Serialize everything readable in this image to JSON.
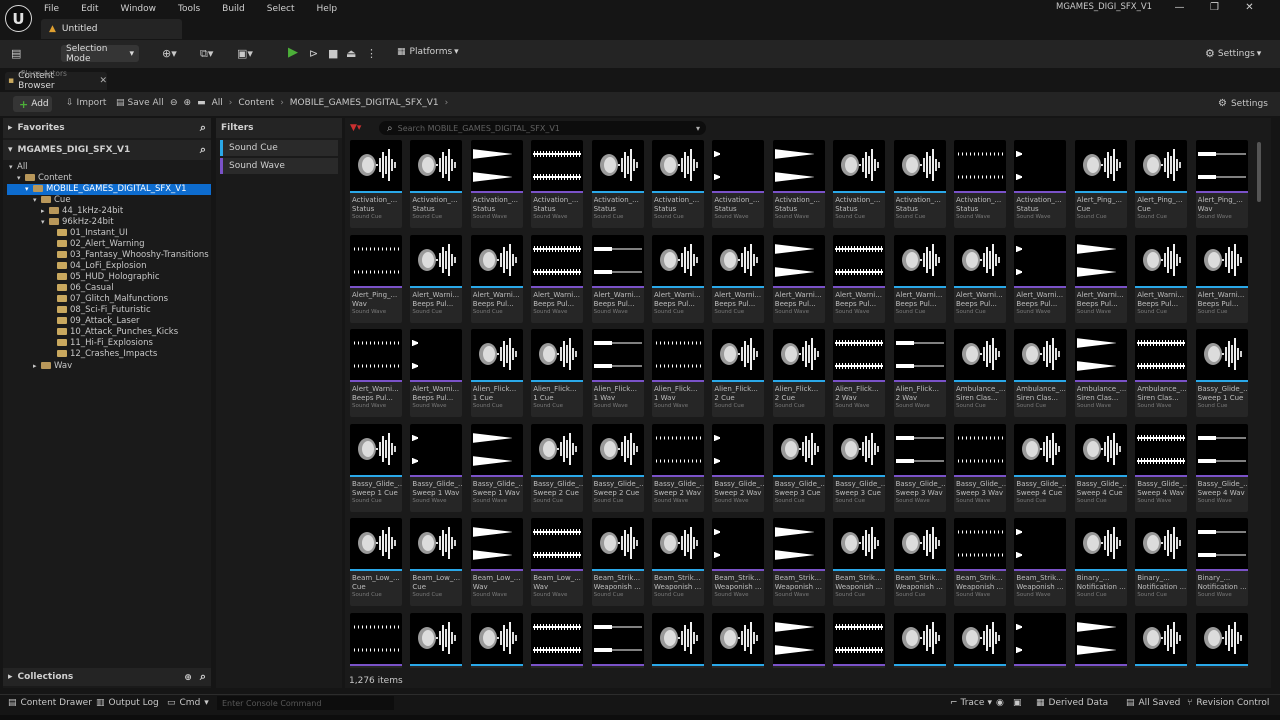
{
  "app": {
    "logo_letter": "U",
    "menu": [
      "File",
      "Edit",
      "Window",
      "Tools",
      "Build",
      "Select",
      "Help"
    ],
    "doc_tab": "Untitled",
    "project": "MGAMES_DIGI_SFX_V1",
    "window_controls": [
      "—",
      "❐",
      "✕"
    ]
  },
  "toolbar": {
    "mode": "Selection Mode",
    "platforms": "Platforms",
    "settings": "Settings"
  },
  "tabs": {
    "ghost": "Place Actors",
    "content_browser": "Content Browser"
  },
  "browser": {
    "add": "Add",
    "import": "Import",
    "save_all": "Save All",
    "breadcrumbs": [
      "All",
      "Content",
      "MOBILE_GAMES_DIGITAL_SFX_V1"
    ],
    "settings": "Settings",
    "search_placeholder": "Search MOBILE_GAMES_DIGITAL_SFX_V1",
    "item_count": "1,276 items"
  },
  "left": {
    "favorites": "Favorites",
    "root": "MGAMES_DIGI_SFX_V1",
    "collections": "Collections",
    "tree": [
      {
        "label": "All",
        "depth": 0,
        "folder": false,
        "sel": false
      },
      {
        "label": "Content",
        "depth": 1,
        "folder": true,
        "sel": false
      },
      {
        "label": "MOBILE_GAMES_DIGITAL_SFX_V1",
        "depth": 2,
        "folder": true,
        "sel": true
      },
      {
        "label": "Cue",
        "depth": 3,
        "folder": true,
        "sel": false
      },
      {
        "label": "44_1kHz-24bit",
        "depth": 4,
        "folder": true,
        "sel": false
      },
      {
        "label": "96kHz-24bit",
        "depth": 4,
        "folder": true,
        "sel": false
      },
      {
        "label": "01_Instant_UI",
        "depth": 5,
        "folder": true,
        "sel": false
      },
      {
        "label": "02_Alert_Warning",
        "depth": 5,
        "folder": true,
        "sel": false
      },
      {
        "label": "03_Fantasy_Whooshy-Transitions",
        "depth": 5,
        "folder": true,
        "sel": false
      },
      {
        "label": "04_LoFi_Explosion",
        "depth": 5,
        "folder": true,
        "sel": false
      },
      {
        "label": "05_HUD_Holographic",
        "depth": 5,
        "folder": true,
        "sel": false
      },
      {
        "label": "06_Casual",
        "depth": 5,
        "folder": true,
        "sel": false
      },
      {
        "label": "07_Glitch_Malfunctions",
        "depth": 5,
        "folder": true,
        "sel": false
      },
      {
        "label": "08_Sci-Fi_Futuristic",
        "depth": 5,
        "folder": true,
        "sel": false
      },
      {
        "label": "09_Attack_Laser",
        "depth": 5,
        "folder": true,
        "sel": false
      },
      {
        "label": "10_Attack_Punches_Kicks",
        "depth": 5,
        "folder": true,
        "sel": false
      },
      {
        "label": "11_Hi-Fi_Explosions",
        "depth": 5,
        "folder": true,
        "sel": false
      },
      {
        "label": "12_Crashes_Impacts",
        "depth": 5,
        "folder": true,
        "sel": false
      },
      {
        "label": "Wav",
        "depth": 3,
        "folder": true,
        "sel": false
      }
    ]
  },
  "filters": {
    "title": "Filters",
    "items": [
      {
        "label": "Sound Cue",
        "color": "#2aa8e8"
      },
      {
        "label": "Sound Wave",
        "color": "#7a52c8"
      }
    ]
  },
  "colors": {
    "cue": "#2aa8e8",
    "wave": "#7a52c8"
  },
  "assets": [
    {
      "n1": "Activation_...",
      "n2": "Status",
      "type": "Sound Cue",
      "kind": "cue"
    },
    {
      "n1": "Activation_...",
      "n2": "Status",
      "type": "Sound Cue",
      "kind": "cue"
    },
    {
      "n1": "Activation_...",
      "n2": "Status",
      "type": "Sound Wave",
      "kind": "wave"
    },
    {
      "n1": "Activation_...",
      "n2": "Status",
      "type": "Sound Wave",
      "kind": "wave"
    },
    {
      "n1": "Activation_...",
      "n2": "Status",
      "type": "Sound Cue",
      "kind": "cue"
    },
    {
      "n1": "Activation_...",
      "n2": "Status",
      "type": "Sound Cue",
      "kind": "cue"
    },
    {
      "n1": "Activation_...",
      "n2": "Status",
      "type": "Sound Wave",
      "kind": "wave"
    },
    {
      "n1": "Activation_...",
      "n2": "Status",
      "type": "Sound Wave",
      "kind": "wave"
    },
    {
      "n1": "Activation_...",
      "n2": "Status",
      "type": "Sound Cue",
      "kind": "cue"
    },
    {
      "n1": "Activation_...",
      "n2": "Status",
      "type": "Sound Cue",
      "kind": "cue"
    },
    {
      "n1": "Activation_...",
      "n2": "Status",
      "type": "Sound Wave",
      "kind": "wave"
    },
    {
      "n1": "Activation_...",
      "n2": "Status",
      "type": "Sound Wave",
      "kind": "wave"
    },
    {
      "n1": "Alert_Ping_...",
      "n2": "Cue",
      "type": "Sound Cue",
      "kind": "cue"
    },
    {
      "n1": "Alert_Ping_...",
      "n2": "Cue",
      "type": "Sound Cue",
      "kind": "cue"
    },
    {
      "n1": "Alert_Ping_...",
      "n2": "Wav",
      "type": "Sound Wave",
      "kind": "wave"
    },
    {
      "n1": "Alert_Ping_...",
      "n2": "Wav",
      "type": "Sound Wave",
      "kind": "wave"
    },
    {
      "n1": "Alert_Warni...",
      "n2": "Beeps Pul...",
      "type": "Sound Cue",
      "kind": "cue"
    },
    {
      "n1": "Alert_Warni...",
      "n2": "Beeps Pul...",
      "type": "Sound Cue",
      "kind": "cue"
    },
    {
      "n1": "Alert_Warni...",
      "n2": "Beeps Pul...",
      "type": "Sound Wave",
      "kind": "wave"
    },
    {
      "n1": "Alert_Warni...",
      "n2": "Beeps Pul...",
      "type": "Sound Wave",
      "kind": "wave"
    },
    {
      "n1": "Alert_Warni...",
      "n2": "Beeps Pul...",
      "type": "Sound Cue",
      "kind": "cue"
    },
    {
      "n1": "Alert_Warni...",
      "n2": "Beeps Pul...",
      "type": "Sound Cue",
      "kind": "cue"
    },
    {
      "n1": "Alert_Warni...",
      "n2": "Beeps Pul...",
      "type": "Sound Wave",
      "kind": "wave"
    },
    {
      "n1": "Alert_Warni...",
      "n2": "Beeps Pul...",
      "type": "Sound Wave",
      "kind": "wave"
    },
    {
      "n1": "Alert_Warni...",
      "n2": "Beeps Pul...",
      "type": "Sound Cue",
      "kind": "cue"
    },
    {
      "n1": "Alert_Warni...",
      "n2": "Beeps Pul...",
      "type": "Sound Cue",
      "kind": "cue"
    },
    {
      "n1": "Alert_Warni...",
      "n2": "Beeps Pul...",
      "type": "Sound Wave",
      "kind": "wave"
    },
    {
      "n1": "Alert_Warni...",
      "n2": "Beeps Pul...",
      "type": "Sound Wave",
      "kind": "wave"
    },
    {
      "n1": "Alert_Warni...",
      "n2": "Beeps Pul...",
      "type": "Sound Cue",
      "kind": "cue"
    },
    {
      "n1": "Alert_Warni...",
      "n2": "Beeps Pul...",
      "type": "Sound Cue",
      "kind": "cue"
    },
    {
      "n1": "Alert_Warni...",
      "n2": "Beeps Pul...",
      "type": "Sound Wave",
      "kind": "wave"
    },
    {
      "n1": "Alert_Warni...",
      "n2": "Beeps Pul...",
      "type": "Sound Wave",
      "kind": "wave"
    },
    {
      "n1": "Alien_Flick...",
      "n2": "1 Cue",
      "type": "Sound Cue",
      "kind": "cue"
    },
    {
      "n1": "Alien_Flick...",
      "n2": "1 Cue",
      "type": "Sound Cue",
      "kind": "cue"
    },
    {
      "n1": "Alien_Flick...",
      "n2": "1 Wav",
      "type": "Sound Wave",
      "kind": "wave"
    },
    {
      "n1": "Alien_Flick...",
      "n2": "1 Wav",
      "type": "Sound Wave",
      "kind": "wave"
    },
    {
      "n1": "Alien_Flick...",
      "n2": "2 Cue",
      "type": "Sound Cue",
      "kind": "cue"
    },
    {
      "n1": "Alien_Flick...",
      "n2": "2 Cue",
      "type": "Sound Cue",
      "kind": "cue"
    },
    {
      "n1": "Alien_Flick...",
      "n2": "2 Wav",
      "type": "Sound Wave",
      "kind": "wave"
    },
    {
      "n1": "Alien_Flick...",
      "n2": "2 Wav",
      "type": "Sound Wave",
      "kind": "wave"
    },
    {
      "n1": "Ambulance_...",
      "n2": "Siren Clas...",
      "type": "Sound Cue",
      "kind": "cue"
    },
    {
      "n1": "Ambulance_...",
      "n2": "Siren Clas...",
      "type": "Sound Cue",
      "kind": "cue"
    },
    {
      "n1": "Ambulance_...",
      "n2": "Siren Clas...",
      "type": "Sound Wave",
      "kind": "wave"
    },
    {
      "n1": "Ambulance_...",
      "n2": "Siren Clas...",
      "type": "Sound Wave",
      "kind": "wave"
    },
    {
      "n1": "Bassy_Glide_...",
      "n2": "Sweep 1 Cue",
      "type": "Sound Cue",
      "kind": "cue"
    },
    {
      "n1": "Bassy_Glide_...",
      "n2": "Sweep 1 Cue",
      "type": "Sound Cue",
      "kind": "cue"
    },
    {
      "n1": "Bassy_Glide_...",
      "n2": "Sweep 1 Wav",
      "type": "Sound Wave",
      "kind": "wave"
    },
    {
      "n1": "Bassy_Glide_...",
      "n2": "Sweep 1 Wav",
      "type": "Sound Wave",
      "kind": "wave"
    },
    {
      "n1": "Bassy_Glide_...",
      "n2": "Sweep 2 Cue",
      "type": "Sound Cue",
      "kind": "cue"
    },
    {
      "n1": "Bassy_Glide_...",
      "n2": "Sweep 2 Cue",
      "type": "Sound Cue",
      "kind": "cue"
    },
    {
      "n1": "Bassy_Glide_...",
      "n2": "Sweep 2 Wav",
      "type": "Sound Wave",
      "kind": "wave"
    },
    {
      "n1": "Bassy_Glide_...",
      "n2": "Sweep 2 Wav",
      "type": "Sound Wave",
      "kind": "wave"
    },
    {
      "n1": "Bassy_Glide_...",
      "n2": "Sweep 3 Cue",
      "type": "Sound Cue",
      "kind": "cue"
    },
    {
      "n1": "Bassy_Glide_...",
      "n2": "Sweep 3 Cue",
      "type": "Sound Cue",
      "kind": "cue"
    },
    {
      "n1": "Bassy_Glide_...",
      "n2": "Sweep 3 Wav",
      "type": "Sound Wave",
      "kind": "wave"
    },
    {
      "n1": "Bassy_Glide_...",
      "n2": "Sweep 3 Wav",
      "type": "Sound Wave",
      "kind": "wave"
    },
    {
      "n1": "Bassy_Glide_...",
      "n2": "Sweep 4 Cue",
      "type": "Sound Cue",
      "kind": "cue"
    },
    {
      "n1": "Bassy_Glide_...",
      "n2": "Sweep 4 Cue",
      "type": "Sound Cue",
      "kind": "cue"
    },
    {
      "n1": "Bassy_Glide_...",
      "n2": "Sweep 4 Wav",
      "type": "Sound Wave",
      "kind": "wave"
    },
    {
      "n1": "Bassy_Glide_...",
      "n2": "Sweep 4 Wav",
      "type": "Sound Wave",
      "kind": "wave"
    },
    {
      "n1": "Beam_Low_...",
      "n2": "Cue",
      "type": "Sound Cue",
      "kind": "cue"
    },
    {
      "n1": "Beam_Low_...",
      "n2": "Cue",
      "type": "Sound Cue",
      "kind": "cue"
    },
    {
      "n1": "Beam_Low_...",
      "n2": "Wav",
      "type": "Sound Wave",
      "kind": "wave"
    },
    {
      "n1": "Beam_Low_...",
      "n2": "Wav",
      "type": "Sound Wave",
      "kind": "wave"
    },
    {
      "n1": "Beam_Strik...",
      "n2": "Weaponish ...",
      "type": "Sound Cue",
      "kind": "cue"
    },
    {
      "n1": "Beam_Strik...",
      "n2": "Weaponish ...",
      "type": "Sound Cue",
      "kind": "cue"
    },
    {
      "n1": "Beam_Strik...",
      "n2": "Weaponish ...",
      "type": "Sound Wave",
      "kind": "wave"
    },
    {
      "n1": "Beam_Strik...",
      "n2": "Weaponish ...",
      "type": "Sound Wave",
      "kind": "wave"
    },
    {
      "n1": "Beam_Strik...",
      "n2": "Weaponish ...",
      "type": "Sound Cue",
      "kind": "cue"
    },
    {
      "n1": "Beam_Strik...",
      "n2": "Weaponish ...",
      "type": "Sound Cue",
      "kind": "cue"
    },
    {
      "n1": "Beam_Strik...",
      "n2": "Weaponish ...",
      "type": "Sound Wave",
      "kind": "wave"
    },
    {
      "n1": "Beam_Strik...",
      "n2": "Weaponish ...",
      "type": "Sound Wave",
      "kind": "wave"
    },
    {
      "n1": "Binary_...",
      "n2": "Notification ...",
      "type": "Sound Cue",
      "kind": "cue"
    },
    {
      "n1": "Binary_...",
      "n2": "Notification ...",
      "type": "Sound Cue",
      "kind": "cue"
    },
    {
      "n1": "Binary_...",
      "n2": "Notification ...",
      "type": "Sound Wave",
      "kind": "wave"
    },
    {
      "n1": "",
      "n2": "",
      "type": "",
      "kind": "wave"
    },
    {
      "n1": "",
      "n2": "",
      "type": "",
      "kind": "cue"
    },
    {
      "n1": "",
      "n2": "",
      "type": "",
      "kind": "cue"
    },
    {
      "n1": "",
      "n2": "",
      "type": "",
      "kind": "wave"
    },
    {
      "n1": "",
      "n2": "",
      "type": "",
      "kind": "wave"
    },
    {
      "n1": "",
      "n2": "",
      "type": "",
      "kind": "cue"
    },
    {
      "n1": "",
      "n2": "",
      "type": "",
      "kind": "cue"
    },
    {
      "n1": "",
      "n2": "",
      "type": "",
      "kind": "wave"
    },
    {
      "n1": "",
      "n2": "",
      "type": "",
      "kind": "wave"
    },
    {
      "n1": "",
      "n2": "",
      "type": "",
      "kind": "cue"
    },
    {
      "n1": "",
      "n2": "",
      "type": "",
      "kind": "cue"
    },
    {
      "n1": "",
      "n2": "",
      "type": "",
      "kind": "wave"
    },
    {
      "n1": "",
      "n2": "",
      "type": "",
      "kind": "wave"
    },
    {
      "n1": "",
      "n2": "",
      "type": "",
      "kind": "cue"
    },
    {
      "n1": "",
      "n2": "",
      "type": "",
      "kind": "cue"
    }
  ],
  "status": {
    "content_drawer": "Content Drawer",
    "output_log": "Output Log",
    "cmd": "Cmd",
    "console_placeholder": "Enter Console Command",
    "trace": "Trace",
    "derived_data": "Derived Data",
    "all_saved": "All Saved",
    "revision_control": "Revision Control"
  }
}
